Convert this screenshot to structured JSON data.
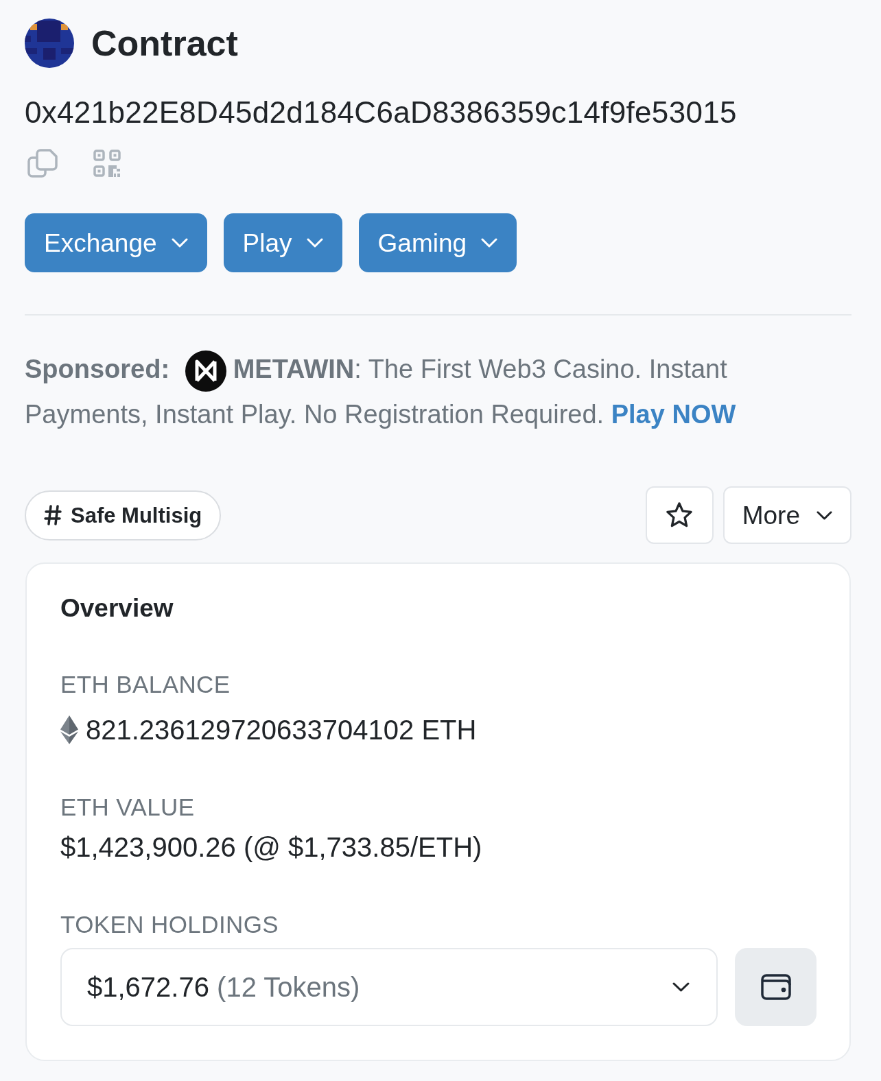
{
  "header": {
    "title": "Contract",
    "address": "0x421b22E8D45d2d184C6aD8386359c14f9fe53015"
  },
  "category_buttons": [
    {
      "label": "Exchange"
    },
    {
      "label": "Play"
    },
    {
      "label": "Gaming"
    }
  ],
  "sponsored": {
    "label": "Sponsored:",
    "message": "**METAWIN**: The First Web3 Casino. Instant Payments, Instant Play. No Registration Required.",
    "link": "Play NOW"
  },
  "tag": {
    "label": "Safe Multisig"
  },
  "more_button": {
    "label": "More"
  },
  "overview": {
    "title": "Overview",
    "fields": [
      {
        "kind": "balance",
        "label": "ETH BALANCE",
        "value": "821.236129720633704102 ETH"
      },
      {
        "kind": "plain",
        "label": "ETH VALUE",
        "value": "$1,423,900.26 (@ $1,733.85/ETH)"
      },
      {
        "kind": "holdings",
        "label": "TOKEN HOLDINGS",
        "value": "$1,672.76",
        "count": "(12 Tokens)"
      }
    ]
  }
}
